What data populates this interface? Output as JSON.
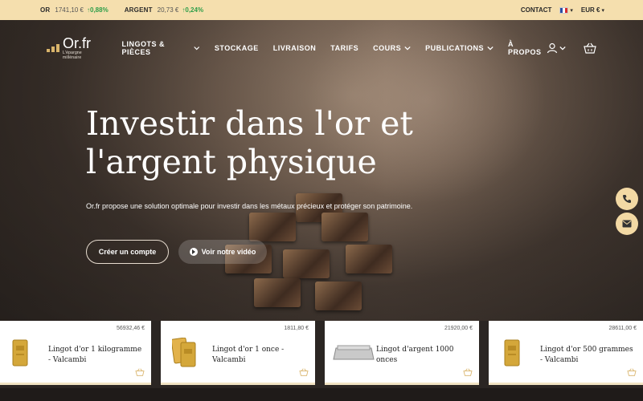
{
  "topbar": {
    "tickers": [
      {
        "name": "OR",
        "price": "1741,10 €",
        "delta": "0,88%"
      },
      {
        "name": "ARGENT",
        "price": "20,73 €",
        "delta": "0,24%"
      }
    ],
    "contact": "CONTACT",
    "currency": "EUR €"
  },
  "nav": {
    "logo": "Or.fr",
    "logo_tagline": "L'épargne millénaire",
    "items": [
      {
        "label": "LINGOTS & PIÈCES",
        "dropdown": true
      },
      {
        "label": "STOCKAGE",
        "dropdown": false
      },
      {
        "label": "LIVRAISON",
        "dropdown": false
      },
      {
        "label": "TARIFS",
        "dropdown": false
      },
      {
        "label": "COURS",
        "dropdown": true
      },
      {
        "label": "PUBLICATIONS",
        "dropdown": true
      },
      {
        "label": "À PROPOS",
        "dropdown": false
      }
    ]
  },
  "hero": {
    "title": "Investir dans l'or et l'argent physique",
    "subtitle": "Or.fr propose une solution optimale pour investir dans les métaux précieux et protéger son patrimoine.",
    "cta_primary": "Créer un compte",
    "cta_video": "Voir notre vidéo"
  },
  "products": [
    {
      "price": "56932,46 €",
      "name": "Lingot d'or 1 kilogramme - Valcambi",
      "thumb": "gold-bar-icon"
    },
    {
      "price": "1811,80 €",
      "name": "Lingot d'or 1 once - Valcambi",
      "thumb": "gold-bar-icon"
    },
    {
      "price": "21920,00 €",
      "name": "Lingot d'argent 1000 onces",
      "thumb": "silver-bar-icon"
    },
    {
      "price": "28611,00 €",
      "name": "Lingot d'or 500 grammes - Valcambi",
      "thumb": "gold-bar-icon"
    }
  ],
  "colors": {
    "accent": "#f5dfae",
    "up": "#2e9e49",
    "gold": "#d9b46b"
  }
}
